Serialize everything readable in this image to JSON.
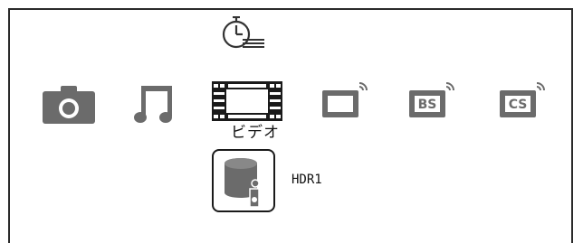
{
  "media_bar": {
    "items": [
      {
        "id": "photo",
        "icon": "camera-icon"
      },
      {
        "id": "music",
        "icon": "music-note-icon"
      },
      {
        "id": "video",
        "icon": "film-strip-icon",
        "label": "ビデオ",
        "selected": true
      },
      {
        "id": "terrestrial",
        "icon": "tv-broadcast-icon"
      },
      {
        "id": "bs",
        "icon": "bs-broadcast-icon",
        "badge": "BS"
      },
      {
        "id": "cs",
        "icon": "cs-broadcast-icon",
        "badge": "CS"
      }
    ]
  },
  "timer": {
    "icon": "timer-list-icon"
  },
  "device": {
    "icon": "hdd-recorder-icon",
    "label": "HDR1"
  },
  "colors": {
    "icon_gray": "#6b6b6b",
    "dark": "#1a1a1a"
  }
}
